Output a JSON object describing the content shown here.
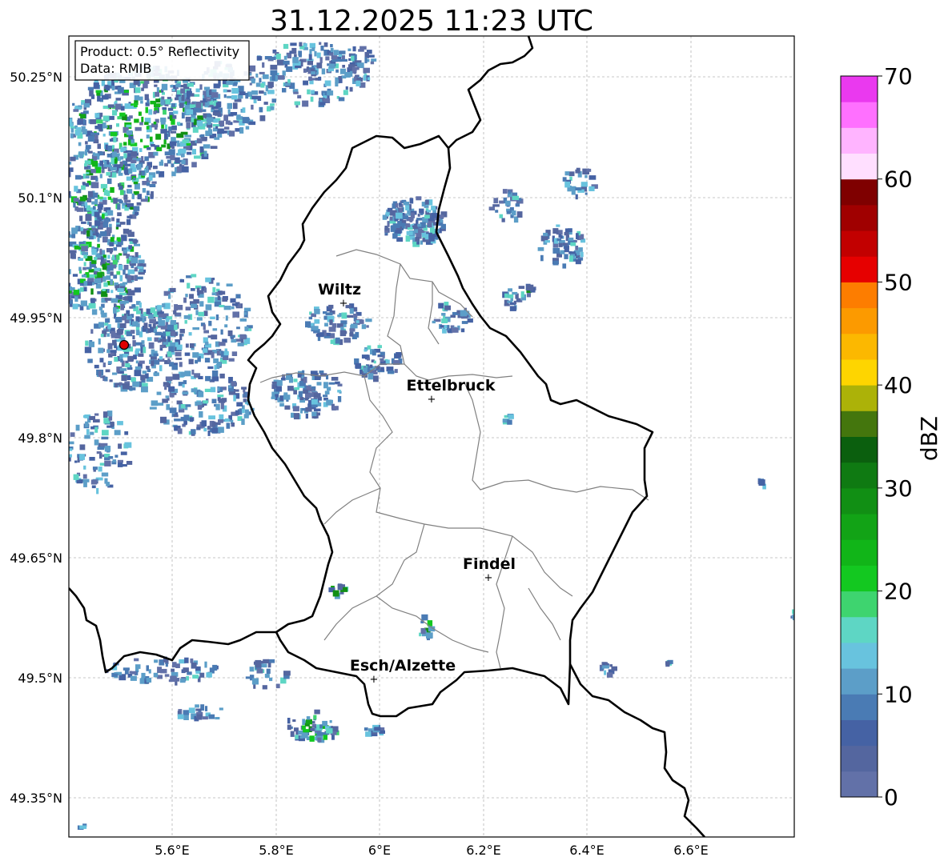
{
  "title": "31.12.2025 11:23 UTC",
  "info_box": {
    "line1": "Product: 0.5° Reflectivity",
    "line2": "Data: RMIB"
  },
  "x_ticks": [
    "5.6°E",
    "5.8°E",
    "6°E",
    "6.2°E",
    "6.4°E",
    "6.6°E"
  ],
  "y_ticks": [
    "50.25°N",
    "50.1°N",
    "49.95°N",
    "49.8°N",
    "49.65°N",
    "49.5°N",
    "49.35°N"
  ],
  "cities": [
    {
      "name": "Wiltz",
      "lon": 5.93,
      "lat": 49.97
    },
    {
      "name": "Ettelbruck",
      "lon": 6.1,
      "lat": 49.85
    },
    {
      "name": "Findel",
      "lon": 6.21,
      "lat": 49.627
    },
    {
      "name": "Esch/Alzette",
      "lon": 5.99,
      "lat": 49.5
    }
  ],
  "radar_site": {
    "lon": 5.505,
    "lat": 49.914,
    "color": "#e00000"
  },
  "colorbar": {
    "label": "dBZ",
    "tick_labels": [
      "0",
      "10",
      "20",
      "30",
      "40",
      "50",
      "60",
      "70"
    ],
    "min": 0,
    "max": 70,
    "step": 2.5,
    "colors": [
      "#6271a8",
      "#54669f",
      "#4562a4",
      "#4a7bb4",
      "#5c9ec8",
      "#68c3de",
      "#5ed6c4",
      "#3ed46f",
      "#13c820",
      "#11b518",
      "#12a316",
      "#118f14",
      "#0f7a12",
      "#0b5f0e",
      "#44760d",
      "#acb208",
      "#fed500",
      "#fcb800",
      "#fc9a00",
      "#fd7d00",
      "#e60000",
      "#c20000",
      "#a00000",
      "#7f0000",
      "#ffdfff",
      "#ffb4ff",
      "#ff70ff",
      "#ea39ef"
    ]
  }
}
